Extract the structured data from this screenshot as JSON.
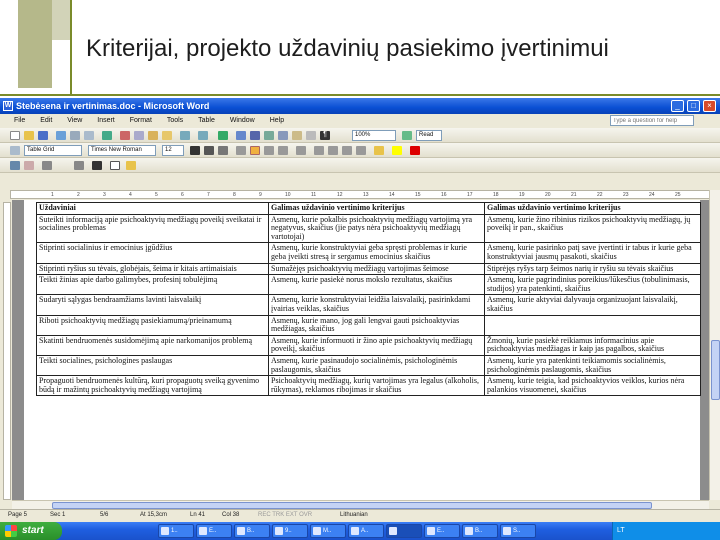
{
  "slide": {
    "title": "Kriterijai, projekto uždavinių pasiekimo įvertinimui"
  },
  "window": {
    "title": "Stebėsena ir vertinimas.doc - Microsoft Word",
    "buttons": {
      "minimize": "_",
      "maximize": "□",
      "close": "×"
    }
  },
  "menu": [
    "File",
    "Edit",
    "View",
    "Insert",
    "Format",
    "Tools",
    "Table",
    "Window",
    "Help"
  ],
  "help_box": {
    "placeholder": "Type a question for help"
  },
  "toolbar": {
    "zoom": "100%",
    "read": "Read",
    "style": "Table Grid",
    "font": "Times New Roman",
    "size": "12"
  },
  "ruler_marks": [
    "1",
    "2",
    "3",
    "4",
    "5",
    "6",
    "7",
    "8",
    "9",
    "10",
    "11",
    "12",
    "13",
    "14",
    "15",
    "16",
    "17",
    "18",
    "19",
    "20",
    "21",
    "22",
    "23",
    "24",
    "25"
  ],
  "table": {
    "headers": [
      "Uždaviniai",
      "Galimas uždavinio vertinimo kriterijus",
      "Galimas uždavinio vertinimo kriterijus"
    ],
    "rows": [
      [
        "Suteikti informaciją apie psichoaktyvių medžiagų poveikį sveikatai ir socialines problemas",
        "Asmenų, kurie pokalbis psichoaktyvių medžiagų vartojimą yra negatyvus, skaičius (jie patys nėra psichoaktyvių medžiagų vartotojai)",
        "Asmenų, kurie žino ribinius rizikos psichoaktyvių medžiagų, jų poveikį ir pan., skaičius"
      ],
      [
        "Stiprinti socialinius ir emocinius įgūdžius",
        "Asmenų, kurie konstruktyviai geba spręsti problemas ir kurie geba įveikti stresą ir sergamus emocinius skaičius",
        "Asmenų, kurie pasirinko patį save įvertinti ir tabus ir kurie geba konstruktyviai jausmų pasakoti, skaičius"
      ],
      [
        "Stiprinti ryšius su tėvais, globėjais, šeima ir kitais artimaisiais",
        "Sumažėjęs psichoaktyvių medžiagų vartojimas šeimose",
        "Stiprėjęs ryšys tarp šeimos narių ir ryšiu su tėvais skaičius"
      ],
      [
        "Teikti žinias apie darbo galimybes, profesinį tobulėjimą",
        "Asmenų, kurie pasiekė norus mokslo rezultatus, skaičius",
        "Asmenų, kurie pagrindinius poreikius/lūkesčius (tobulinimasis, studijos) yra patenkinti, skaičius"
      ],
      [
        "Sudaryti sąlygas bendraamžiams lavinti laisvalaikį",
        "Asmenų, kurie konstruktyviai leidžia laisvalaikį, pasirinkdami įvairias veiklas, skaičius",
        "Asmenų, kurie aktyviai dalyvauja organizuojant laisvalaikį, skaičius"
      ],
      [
        "Riboti psichoaktyvių medžiagų pasiekiamumą/prieinamumą",
        "Asmenų, kurie mano, jog gali lengvai gauti psichoaktyvias medžiagas, skaičius",
        ""
      ],
      [
        "Skatinti bendruomenės susidomėjimą apie narkomanijos problemą",
        "Asmenų, kurie informuoti ir žino apie psichoaktyvių medžiagų poveikį, skaičius",
        "Žmonių, kurie pasiekė reikiamus informacinius apie psichoaktyvias medžiagas ir kaip jas pagalbos, skaičius"
      ],
      [
        "Teikti socialines, psichologines paslaugas",
        "Asmenų, kurie pasinaudojo socialinėmis, psichologinėmis paslaugomis, skaičius",
        "Asmenų, kurie yra patenkinti teikiamomis socialinėmis, psichologinėmis paslaugomis, skaičius"
      ],
      [
        "Propaguoti bendruomenės kultūrą, kuri propaguotų sveiką gyvenimo būdą ir mažintų psichoaktyvių medžiagų vartojimą",
        "Psichoaktyvių medžiagų, kurių vartojimas yra legalus (alkoholis, rūkymas), reklamos ribojimas ir skaičius",
        "Asmenų, kurie teigia, kad psichoaktyvios veiklos, kurios nėra palankios visuomenei, skaičius"
      ]
    ]
  },
  "statusbar": {
    "page": "Page 5",
    "sec": "Sec 1",
    "pages": "5/6",
    "at": "At 15,3cm",
    "ln": "Ln 41",
    "col": "Col 38",
    "flags": "REC  TRK  EXT  OVR",
    "language": "Lithuanian"
  },
  "taskbar": {
    "start": "start",
    "tasks": [
      "1..",
      "E..",
      "B..",
      "9..",
      "M..",
      "A..",
      "",
      "E..",
      "B..",
      "S.."
    ],
    "tray": "LT"
  },
  "colors": {
    "titlebar": "#0a4fd4",
    "taskbar": "#1f5fe0",
    "start": "#2a8f2a",
    "accent": "#7a8b2a"
  }
}
